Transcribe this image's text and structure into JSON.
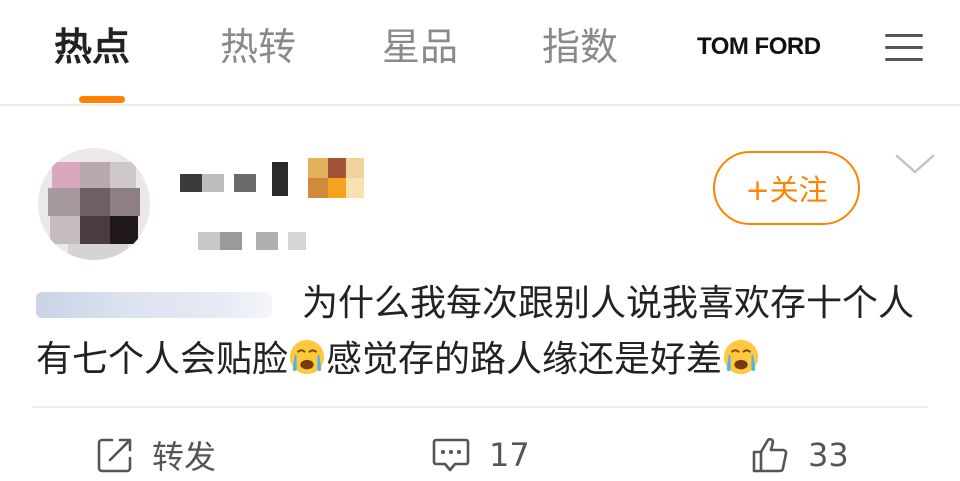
{
  "nav": {
    "tabs": [
      {
        "label": "热点",
        "active": true
      },
      {
        "label": "热转",
        "active": false
      },
      {
        "label": "星品",
        "active": false
      },
      {
        "label": "指数",
        "active": false
      }
    ],
    "brand": "TOM FORD",
    "accent_color": "#ff8200"
  },
  "post": {
    "follow_label": "+关注",
    "text_part1": "为什么我每次跟别人说我喜欢存十个人有七个人会贴脸",
    "text_part2": "感觉存的路人缘还是好差",
    "emoji": "crying-face-emoji"
  },
  "actions": {
    "repost_label": "转发",
    "comment_count": "17",
    "like_count": "33"
  }
}
